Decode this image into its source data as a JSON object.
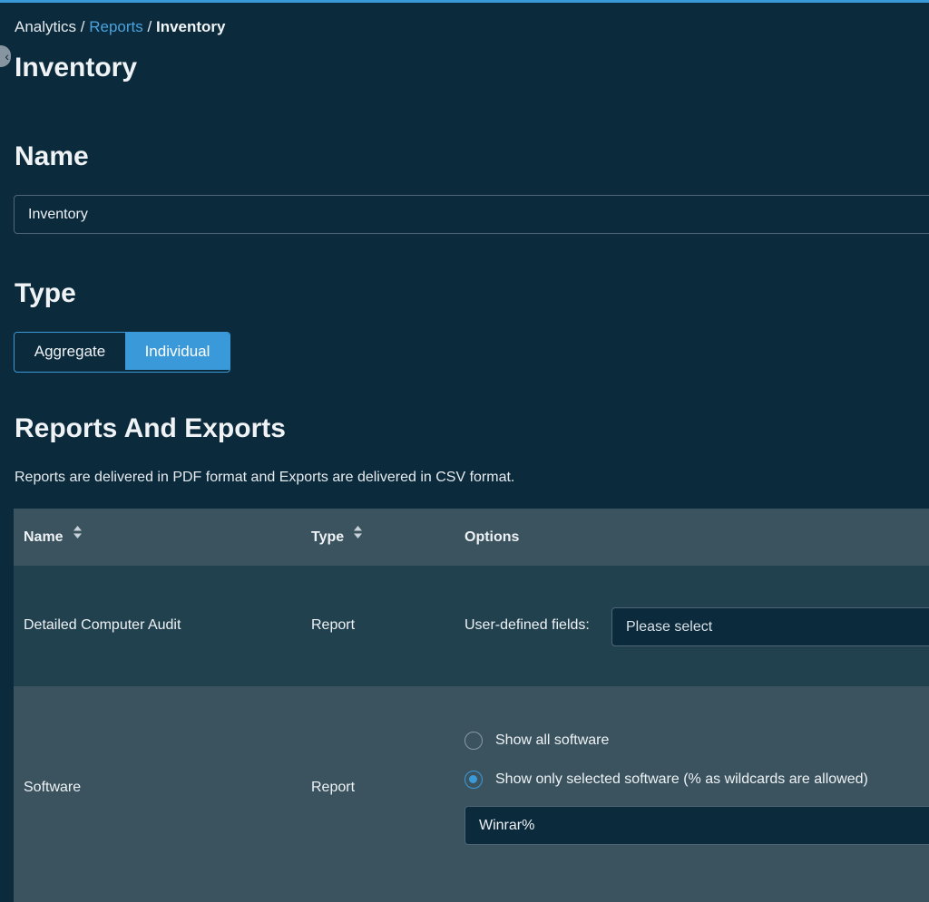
{
  "breadcrumb": {
    "root": "Analytics",
    "separator": "/",
    "parent": "Reports",
    "current": "Inventory"
  },
  "page": {
    "title": "Inventory",
    "collapse_icon": "chevron-left-icon"
  },
  "name_section": {
    "heading": "Name",
    "value": "Inventory"
  },
  "type_section": {
    "heading": "Type",
    "options": [
      "Aggregate",
      "Individual"
    ],
    "selected": "Individual"
  },
  "reports_section": {
    "heading": "Reports And Exports",
    "description": "Reports are delivered in PDF format and Exports are delivered in CSV format.",
    "table": {
      "columns": [
        {
          "label": "Name",
          "sortable": true
        },
        {
          "label": "Type",
          "sortable": true
        },
        {
          "label": "Options",
          "sortable": false
        }
      ],
      "rows": [
        {
          "name": "Detailed Computer Audit",
          "type": "Report",
          "options": {
            "label": "User-defined fields:",
            "select_placeholder": "Please select"
          }
        },
        {
          "name": "Software",
          "type": "Report",
          "options": {
            "radio_all": "Show all software",
            "radio_selected": "Show only selected software (% as wildcards are allowed)",
            "selected_radio": "radio_selected",
            "filter_value": "Winrar%"
          }
        }
      ]
    }
  },
  "colors": {
    "background": "#0b2a3b",
    "accent": "#3a9ad9",
    "table_header": "#3a535f",
    "row_dark": "#22414f",
    "row_light": "#3a535f"
  }
}
